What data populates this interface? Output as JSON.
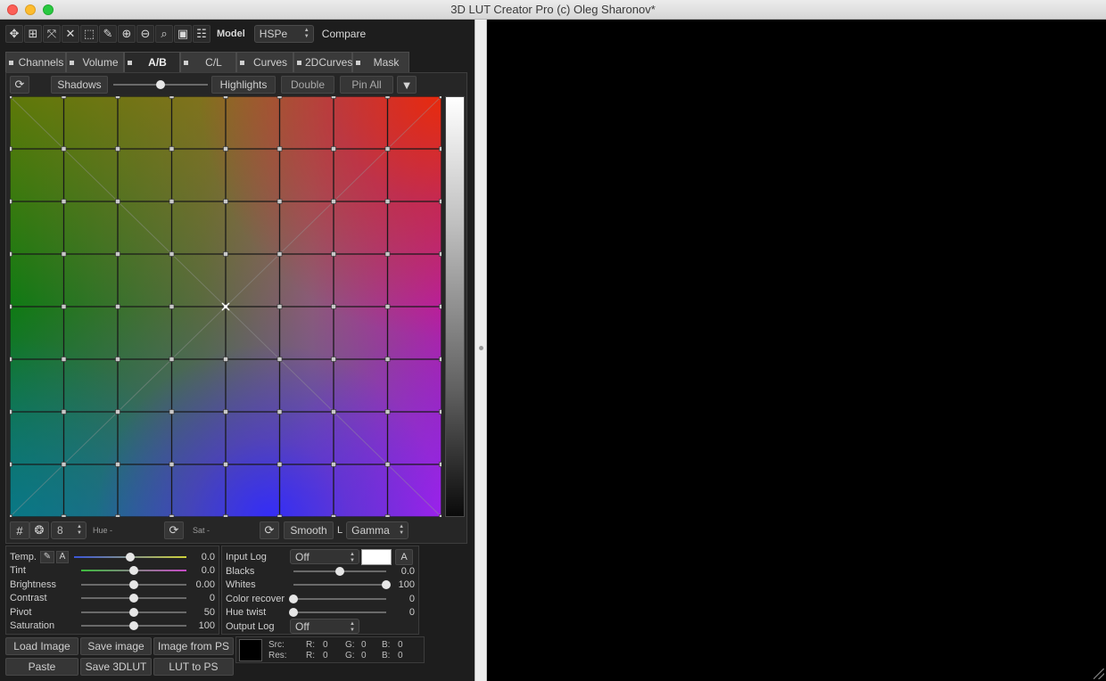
{
  "window": {
    "title": "3D LUT Creator Pro (c) Oleg Sharonov*"
  },
  "toolbar": {
    "tools": [
      {
        "icon": "move-icon",
        "glyph": "✥"
      },
      {
        "icon": "grid-fit-icon",
        "glyph": "⊞"
      },
      {
        "icon": "expand-icon",
        "glyph": "⤧"
      },
      {
        "icon": "collapse-icon",
        "glyph": "✕"
      },
      {
        "icon": "marquee-select-icon",
        "glyph": "⬚"
      },
      {
        "icon": "eyedropper-icon",
        "glyph": "✎"
      },
      {
        "icon": "zoom-in-icon",
        "glyph": "⊕"
      },
      {
        "icon": "zoom-out-icon",
        "glyph": "⊖"
      },
      {
        "icon": "zoom-fit-icon",
        "glyph": "⌕"
      },
      {
        "icon": "frame-icon",
        "glyph": "▣"
      },
      {
        "icon": "filmstrip-icon",
        "glyph": "☷"
      }
    ],
    "model_label": "Model",
    "model_value": "HSPe",
    "compare_label": "Compare"
  },
  "tabs": [
    {
      "label": "Channels",
      "active": false
    },
    {
      "label": "Volume",
      "active": false
    },
    {
      "label": "A/B",
      "active": true
    },
    {
      "label": "C/L",
      "active": false
    },
    {
      "label": "Curves",
      "active": false
    },
    {
      "label": "2DCurves",
      "active": false
    },
    {
      "label": "Mask",
      "active": false
    }
  ],
  "editor": {
    "shadows_label": "Shadows",
    "highlights_label": "Highlights",
    "double_label": "Double",
    "pin_all_label": "Pin All",
    "shadow_highlight_balance": 0.5,
    "grid_size": "8",
    "hue_label": "Hue -",
    "sat_label": "Sat -",
    "smooth_label": "Smooth",
    "l_label": "L",
    "gamma_value": "Gamma"
  },
  "adjustments": {
    "left": [
      {
        "name": "Temp.",
        "value": "0.0",
        "level": 0.5
      },
      {
        "name": "Tint",
        "value": "0.0",
        "level": 0.5
      },
      {
        "name": "Brightness",
        "value": "0.00",
        "level": 0.5
      },
      {
        "name": "Contrast",
        "value": "0",
        "level": 0.5
      },
      {
        "name": "Pivot",
        "value": "50",
        "level": 0.5
      },
      {
        "name": "Saturation",
        "value": "100",
        "level": 0.5
      }
    ],
    "temp_auto": "A",
    "input_log_label": "Input Log",
    "input_log_value": "Off",
    "input_auto": "A",
    "right": [
      {
        "name": "Blacks",
        "value": "0.0",
        "level": 0.5
      },
      {
        "name": "Whites",
        "value": "100",
        "level": 1.0
      },
      {
        "name": "Color recover",
        "value": "0",
        "level": 0.0
      },
      {
        "name": "Hue twist",
        "value": "0",
        "level": 0.0
      }
    ],
    "output_log_label": "Output Log",
    "output_log_value": "Off"
  },
  "buttons": {
    "load_image": "Load Image",
    "save_image": "Save image",
    "image_from_ps": "Image from PS",
    "paste": "Paste",
    "save_3dlut": "Save 3DLUT",
    "lut_to_ps": "LUT to PS"
  },
  "info": {
    "src_label": "Src:",
    "res_label": "Res:",
    "r_label": "R:",
    "g_label": "G:",
    "b_label": "B:",
    "src_r": "0",
    "src_g": "0",
    "src_b": "0",
    "res_r": "0",
    "res_g": "0",
    "res_b": "0"
  }
}
